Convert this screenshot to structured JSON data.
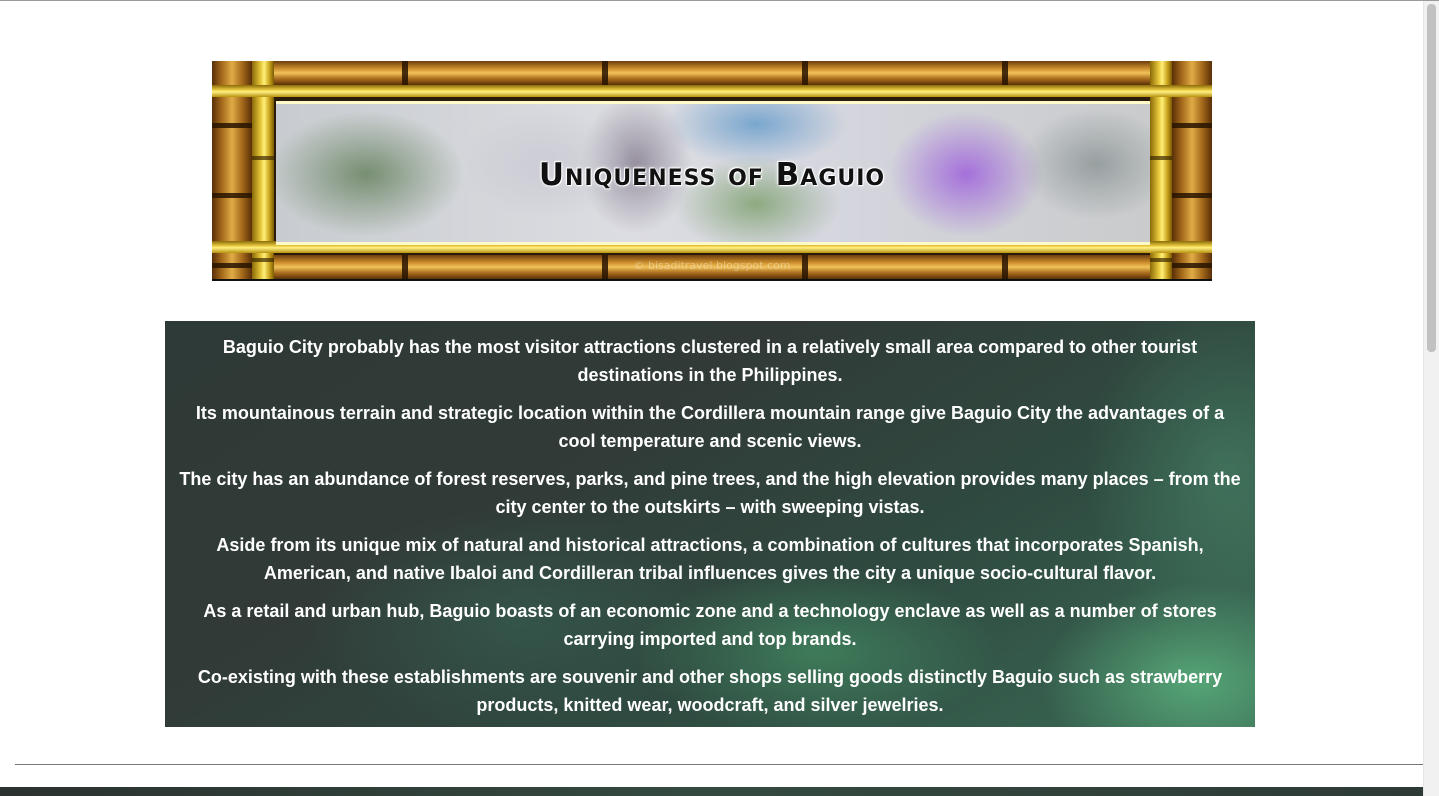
{
  "banner": {
    "title": "Uniqueness of Baguio",
    "watermark": "© bisaditravel.blogspot.com"
  },
  "info": {
    "paragraphs": [
      "Baguio City probably has the most visitor attractions clustered in a relatively small area compared to other tourist destinations in the Philippines.",
      "Its mountainous terrain and strategic location within the Cordillera mountain range give Baguio City the advantages of a cool temperature and scenic views.",
      "The city has an abundance of forest reserves, parks, and pine trees, and the high elevation provides many places – from the city center to the outskirts – with sweeping vistas.",
      "Aside from its unique mix of natural and historical attractions, a combination of cultures that incorporates Spanish, American, and native Ibaloi and Cordilleran tribal influences gives the city a unique socio-cultural flavor.",
      "As a retail and urban hub, Baguio boasts of an economic zone and a technology enclave as well as a number of stores carrying imported and top brands.",
      "Co-existing with these establishments are souvenir and other shops selling goods distinctly Baguio such as strawberry products, knitted wear, woodcraft, and silver jewelries."
    ]
  },
  "colors": {
    "panel_background": "#2f3b38",
    "panel_text": "#ffffff",
    "bamboo": "#c98b2a"
  }
}
